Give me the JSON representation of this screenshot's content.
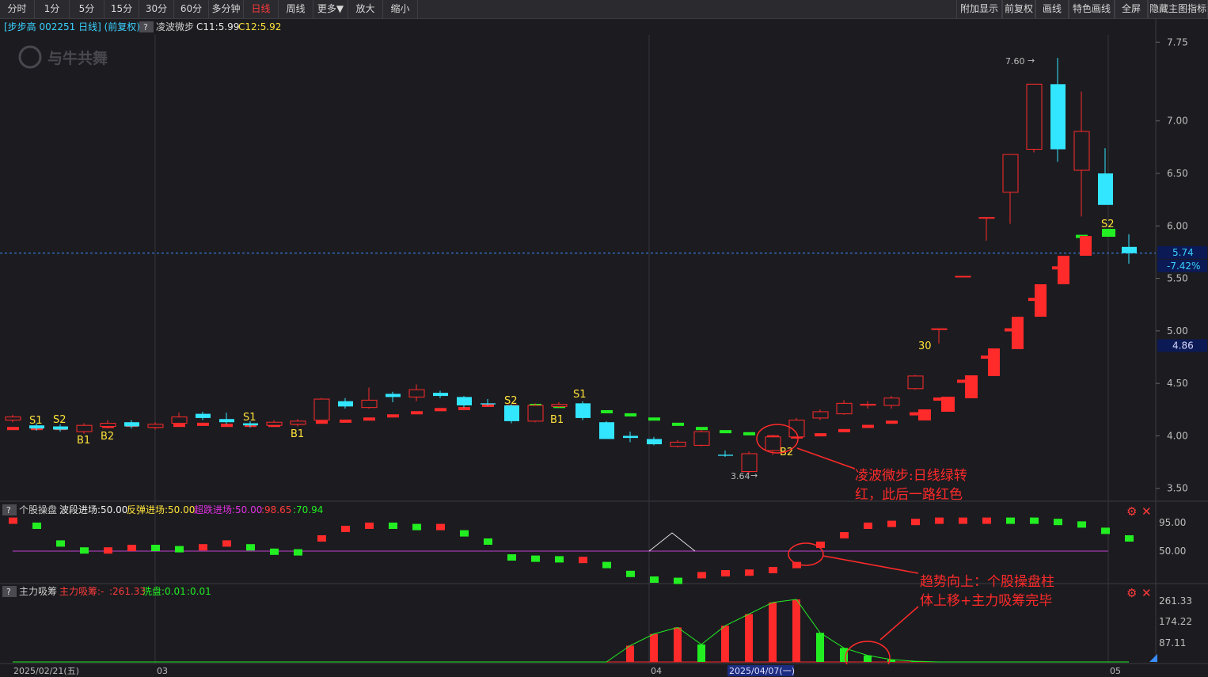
{
  "toolbar": {
    "periods": [
      "分时",
      "1分",
      "5分",
      "15分",
      "30分",
      "60分",
      "多分钟",
      "日线",
      "周线",
      "更多▼",
      "放大",
      "缩小"
    ],
    "active": "日线",
    "right": [
      "附加显示",
      "前复权",
      "画线",
      "特色画线",
      "全屏",
      "隐藏主图指标"
    ]
  },
  "main_header": {
    "stock": "[步步高 002251 日线] (前复权)",
    "help": "?",
    "indicator": "凌波微步",
    "c11": "C11:5.99",
    "c12": "C12:5.92"
  },
  "watermark": "与牛共舞",
  "price_axis": [
    "7.75",
    "7.00",
    "6.50",
    "6.00",
    "5.50",
    "5.00",
    "4.50",
    "4.00",
    "3.50"
  ],
  "current_price": "5.74",
  "current_change": "-7.42%",
  "marker_price": "4.86",
  "high_label": "7.60",
  "low_label": "3.64",
  "signals": {
    "S1": "S1",
    "S2": "S2",
    "B1": "B1",
    "B2": "B2",
    "n30": "30"
  },
  "sub1": {
    "help": "?",
    "name": "个股操盘",
    "p1": "波段进场:50.00",
    "p2": "反弹进场:50.00",
    "p3": "超跌进场:50.00",
    "p4": ":98.65",
    "p5": ":70.94",
    "axis": [
      "95.00",
      "50.00"
    ]
  },
  "sub2": {
    "help": "?",
    "name": "主力吸筹",
    "p1": "主力吸筹:-",
    "p2": ":261.33",
    "p3": "洗盘:0.01",
    "p4": ":0.01",
    "axis": [
      "261.33",
      "174.22",
      "87.11"
    ]
  },
  "x_axis": {
    "d1": "2025/02/21(五)",
    "m03": "03",
    "m04": "04",
    "d2": "2025/04/07(一)",
    "m05": "05"
  },
  "annotations": {
    "a1": "凌波微步:日线绿转\n红，此后一路红色",
    "a2": "趋势向上：个股操盘柱\n体上移+主力吸筹完毕"
  },
  "colors": {
    "up": "#ff2a2a",
    "down": "#33e6ff",
    "green": "#22ee22",
    "bg": "#1c1c20",
    "grid": "#35353b",
    "signal": "#ffe23a"
  },
  "chart_data": {
    "type": "candlestick",
    "title": "步步高 002251 日线 (前复权)",
    "price_range": [
      3.4,
      7.82
    ],
    "candles": [
      {
        "o": 4.15,
        "c": 4.18,
        "h": 4.2,
        "l": 4.13
      },
      {
        "o": 4.1,
        "c": 4.07,
        "h": 4.12,
        "l": 4.05
      },
      {
        "o": 4.09,
        "c": 4.06,
        "h": 4.11,
        "l": 4.04
      },
      {
        "o": 4.04,
        "c": 4.1,
        "h": 4.12,
        "l": 4.02
      },
      {
        "o": 4.09,
        "c": 4.12,
        "h": 4.15,
        "l": 4.07
      },
      {
        "o": 4.13,
        "c": 4.09,
        "h": 4.15,
        "l": 4.07
      },
      {
        "o": 4.08,
        "c": 4.11,
        "h": 4.13,
        "l": 4.06
      },
      {
        "o": 4.12,
        "c": 4.18,
        "h": 4.22,
        "l": 4.1
      },
      {
        "o": 4.21,
        "c": 4.17,
        "h": 4.23,
        "l": 4.15
      },
      {
        "o": 4.16,
        "c": 4.13,
        "h": 4.22,
        "l": 4.11
      },
      {
        "o": 4.12,
        "c": 4.1,
        "h": 4.14,
        "l": 4.08
      },
      {
        "o": 4.1,
        "c": 4.13,
        "h": 4.15,
        "l": 4.09
      },
      {
        "o": 4.11,
        "c": 4.14,
        "h": 4.16,
        "l": 4.09
      },
      {
        "o": 4.15,
        "c": 4.35,
        "h": 4.36,
        "l": 4.14
      },
      {
        "o": 4.33,
        "c": 4.28,
        "h": 4.36,
        "l": 4.26
      },
      {
        "o": 4.27,
        "c": 4.34,
        "h": 4.46,
        "l": 4.26
      },
      {
        "o": 4.4,
        "c": 4.37,
        "h": 4.42,
        "l": 4.32
      },
      {
        "o": 4.37,
        "c": 4.44,
        "h": 4.49,
        "l": 4.33
      },
      {
        "o": 4.41,
        "c": 4.38,
        "h": 4.43,
        "l": 4.36
      },
      {
        "o": 4.37,
        "c": 4.29,
        "h": 4.38,
        "l": 4.27
      },
      {
        "o": 4.31,
        "c": 4.3,
        "h": 4.35,
        "l": 4.29
      },
      {
        "o": 4.29,
        "c": 4.14,
        "h": 4.3,
        "l": 4.12
      },
      {
        "o": 4.14,
        "c": 4.29,
        "h": 4.31,
        "l": 4.13
      },
      {
        "o": 4.28,
        "c": 4.3,
        "h": 4.32,
        "l": 4.27
      },
      {
        "o": 4.31,
        "c": 4.17,
        "h": 4.33,
        "l": 4.15
      },
      {
        "o": 4.13,
        "c": 3.97,
        "h": 4.14,
        "l": 3.97
      },
      {
        "o": 4.0,
        "c": 3.98,
        "h": 4.04,
        "l": 3.94
      },
      {
        "o": 3.97,
        "c": 3.92,
        "h": 3.99,
        "l": 3.91
      },
      {
        "o": 3.9,
        "c": 3.94,
        "h": 3.96,
        "l": 3.89
      },
      {
        "o": 3.91,
        "c": 4.04,
        "h": 4.06,
        "l": 3.9
      },
      {
        "o": 3.82,
        "c": 3.81,
        "h": 3.86,
        "l": 3.8
      },
      {
        "o": 3.66,
        "c": 3.83,
        "h": 3.85,
        "l": 3.64
      },
      {
        "o": 3.86,
        "c": 3.99,
        "h": 4.01,
        "l": 3.82
      },
      {
        "o": 3.99,
        "c": 4.15,
        "h": 4.17,
        "l": 3.97
      },
      {
        "o": 4.17,
        "c": 4.23,
        "h": 4.25,
        "l": 4.15
      },
      {
        "o": 4.21,
        "c": 4.31,
        "h": 4.34,
        "l": 4.2
      },
      {
        "o": 4.3,
        "c": 4.3,
        "h": 4.33,
        "l": 4.26
      },
      {
        "o": 4.29,
        "c": 4.36,
        "h": 4.38,
        "l": 4.26
      },
      {
        "o": 4.45,
        "c": 4.57,
        "h": 4.58,
        "l": 4.44
      },
      {
        "o": 5.02,
        "c": 5.02,
        "h": 5.02,
        "l": 4.88
      },
      {
        "o": 5.52,
        "c": 5.52,
        "h": 5.52,
        "l": 5.52
      },
      {
        "o": 6.08,
        "c": 6.08,
        "h": 6.08,
        "l": 5.86
      },
      {
        "o": 6.32,
        "c": 6.68,
        "h": 6.68,
        "l": 6.02
      },
      {
        "o": 6.73,
        "c": 7.35,
        "h": 7.35,
        "l": 6.7
      },
      {
        "o": 7.35,
        "c": 6.73,
        "h": 7.6,
        "l": 6.61
      },
      {
        "o": 6.53,
        "c": 6.9,
        "h": 7.28,
        "l": 6.09
      },
      {
        "o": 6.5,
        "c": 6.2,
        "h": 6.74,
        "l": 6.2
      },
      {
        "o": 5.8,
        "c": 5.74,
        "h": 5.92,
        "l": 5.64
      }
    ],
    "lingbo_steps": [
      {
        "v": 4.07,
        "c": "red"
      },
      {
        "v": 4.07,
        "c": "red"
      },
      {
        "v": 4.07,
        "c": "red"
      },
      {
        "v": 4.07,
        "c": "red"
      },
      {
        "v": 4.09,
        "c": "red"
      },
      {
        "v": 4.1,
        "c": "red"
      },
      {
        "v": 4.09,
        "c": "red"
      },
      {
        "v": 4.1,
        "c": "red"
      },
      {
        "v": 4.11,
        "c": "red"
      },
      {
        "v": 4.1,
        "c": "red"
      },
      {
        "v": 4.1,
        "c": "red"
      },
      {
        "v": 4.1,
        "c": "red"
      },
      {
        "v": 4.12,
        "c": "red"
      },
      {
        "v": 4.13,
        "c": "red"
      },
      {
        "v": 4.14,
        "c": "red"
      },
      {
        "v": 4.16,
        "c": "red"
      },
      {
        "v": 4.19,
        "c": "red"
      },
      {
        "v": 4.22,
        "c": "red"
      },
      {
        "v": 4.25,
        "c": "red"
      },
      {
        "v": 4.26,
        "c": "red"
      },
      {
        "v": 4.29,
        "c": "red"
      },
      {
        "v": 4.28,
        "c": "red"
      },
      {
        "v": 4.29,
        "c": "green"
      },
      {
        "v": 4.28,
        "c": "green"
      },
      {
        "v": 4.26,
        "c": "green"
      },
      {
        "v": 4.23,
        "c": "green"
      },
      {
        "v": 4.2,
        "c": "green"
      },
      {
        "v": 4.16,
        "c": "green"
      },
      {
        "v": 4.11,
        "c": "green"
      },
      {
        "v": 4.07,
        "c": "green"
      },
      {
        "v": 4.04,
        "c": "green"
      },
      {
        "v": 4.02,
        "c": "green"
      },
      {
        "v": 3.99,
        "c": "red"
      },
      {
        "v": 3.99,
        "c": "red"
      },
      {
        "v": 4.01,
        "c": "red"
      },
      {
        "v": 4.05,
        "c": "red"
      },
      {
        "v": 4.09,
        "c": "red"
      },
      {
        "v": 4.13,
        "c": "red"
      },
      {
        "v": 4.21,
        "c": "red"
      },
      {
        "v": 4.35,
        "c": "red"
      },
      {
        "v": 4.52,
        "c": "red"
      },
      {
        "v": 4.75,
        "c": "red"
      },
      {
        "v": 5.01,
        "c": "red"
      },
      {
        "v": 5.3,
        "c": "red"
      },
      {
        "v": 5.6,
        "c": "red"
      },
      {
        "v": 5.9,
        "c": "green"
      }
    ],
    "caopan": [
      {
        "v": 98,
        "c": "red"
      },
      {
        "v": 90,
        "c": "green"
      },
      {
        "v": 62,
        "c": "green"
      },
      {
        "v": 51,
        "c": "green"
      },
      {
        "v": 51,
        "c": "red"
      },
      {
        "v": 55,
        "c": "red"
      },
      {
        "v": 55,
        "c": "green"
      },
      {
        "v": 53,
        "c": "green"
      },
      {
        "v": 56,
        "c": "red"
      },
      {
        "v": 62,
        "c": "red"
      },
      {
        "v": 56,
        "c": "green"
      },
      {
        "v": 49,
        "c": "green"
      },
      {
        "v": 48,
        "c": "green"
      },
      {
        "v": 70,
        "c": "red"
      },
      {
        "v": 85,
        "c": "red"
      },
      {
        "v": 90,
        "c": "red"
      },
      {
        "v": 90,
        "c": "green"
      },
      {
        "v": 88,
        "c": "green"
      },
      {
        "v": 88,
        "c": "red"
      },
      {
        "v": 78,
        "c": "green"
      },
      {
        "v": 65,
        "c": "green"
      },
      {
        "v": 40,
        "c": "green"
      },
      {
        "v": 38,
        "c": "green"
      },
      {
        "v": 37,
        "c": "green"
      },
      {
        "v": 36,
        "c": "red"
      },
      {
        "v": 28,
        "c": "green"
      },
      {
        "v": 14,
        "c": "green"
      },
      {
        "v": 5,
        "c": "green"
      },
      {
        "v": 3,
        "c": "green"
      },
      {
        "v": 12,
        "c": "red"
      },
      {
        "v": 15,
        "c": "red"
      },
      {
        "v": 16,
        "c": "red"
      },
      {
        "v": 20,
        "c": "red"
      },
      {
        "v": 28,
        "c": "red"
      },
      {
        "v": 60,
        "c": "red"
      },
      {
        "v": 75,
        "c": "red"
      },
      {
        "v": 90,
        "c": "red"
      },
      {
        "v": 93,
        "c": "red"
      },
      {
        "v": 96,
        "c": "red"
      },
      {
        "v": 98,
        "c": "red"
      },
      {
        "v": 98,
        "c": "red"
      },
      {
        "v": 98,
        "c": "red"
      },
      {
        "v": 98,
        "c": "green"
      },
      {
        "v": 98,
        "c": "green"
      },
      {
        "v": 96,
        "c": "green"
      },
      {
        "v": 92,
        "c": "green"
      },
      {
        "v": 82,
        "c": "green"
      },
      {
        "v": 70,
        "c": "green"
      }
    ],
    "xichou": [
      {
        "v": 0,
        "c": "red"
      },
      {
        "v": 0,
        "c": "red"
      },
      {
        "v": 0,
        "c": "red"
      },
      {
        "v": 0,
        "c": "red"
      },
      {
        "v": 0,
        "c": "red"
      },
      {
        "v": 0,
        "c": "red"
      },
      {
        "v": 0,
        "c": "red"
      },
      {
        "v": 0,
        "c": "red"
      },
      {
        "v": 0,
        "c": "red"
      },
      {
        "v": 0,
        "c": "red"
      },
      {
        "v": 0,
        "c": "red"
      },
      {
        "v": 0,
        "c": "red"
      },
      {
        "v": 0,
        "c": "red"
      },
      {
        "v": 0,
        "c": "red"
      },
      {
        "v": 0,
        "c": "red"
      },
      {
        "v": 0,
        "c": "red"
      },
      {
        "v": 0,
        "c": "red"
      },
      {
        "v": 0,
        "c": "red"
      },
      {
        "v": 0,
        "c": "red"
      },
      {
        "v": 0,
        "c": "red"
      },
      {
        "v": 0,
        "c": "red"
      },
      {
        "v": 0,
        "c": "red"
      },
      {
        "v": 0,
        "c": "red"
      },
      {
        "v": 0,
        "c": "red"
      },
      {
        "v": 0,
        "c": "red"
      },
      {
        "v": 0,
        "c": "red"
      },
      {
        "v": 70,
        "c": "red"
      },
      {
        "v": 120,
        "c": "red"
      },
      {
        "v": 148,
        "c": "red"
      },
      {
        "v": 75,
        "c": "green"
      },
      {
        "v": 155,
        "c": "red"
      },
      {
        "v": 205,
        "c": "red"
      },
      {
        "v": 255,
        "c": "red"
      },
      {
        "v": 268,
        "c": "red"
      },
      {
        "v": 125,
        "c": "green"
      },
      {
        "v": 60,
        "c": "green"
      },
      {
        "v": 28,
        "c": "green"
      },
      {
        "v": 10,
        "c": "green"
      },
      {
        "v": 3,
        "c": "green"
      },
      {
        "v": 0.01,
        "c": "green"
      },
      {
        "v": 0.01,
        "c": "green"
      },
      {
        "v": 0.01,
        "c": "green"
      },
      {
        "v": 0.01,
        "c": "green"
      },
      {
        "v": 0.01,
        "c": "green"
      },
      {
        "v": 0.01,
        "c": "green"
      },
      {
        "v": 0.01,
        "c": "green"
      },
      {
        "v": 0.01,
        "c": "green"
      },
      {
        "v": 0.01,
        "c": "green"
      }
    ]
  }
}
